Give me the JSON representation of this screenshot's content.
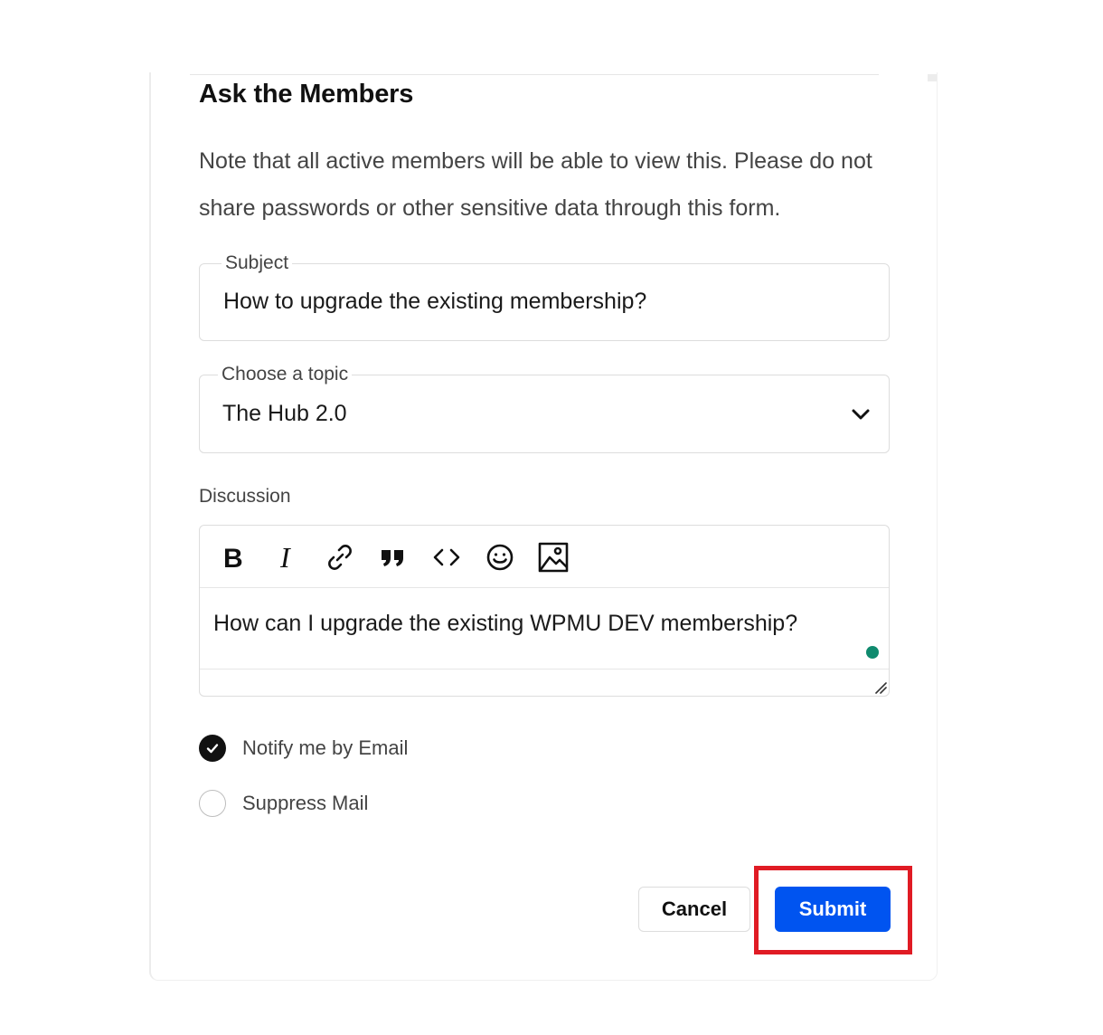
{
  "dialog": {
    "title": "Ask the Members",
    "note": "Note that all active members will be able to view this. Please do not share passwords or other sensitive data through this form."
  },
  "subject": {
    "label": "Subject",
    "value": "How to upgrade the existing membership?"
  },
  "topic": {
    "label": "Choose a topic",
    "selected": "The Hub 2.0",
    "icon": "chevron-down-icon"
  },
  "discussion": {
    "label": "Discussion",
    "toolbar": [
      {
        "name": "bold",
        "icon": "bold-icon"
      },
      {
        "name": "italic",
        "icon": "italic-icon"
      },
      {
        "name": "link",
        "icon": "link-icon"
      },
      {
        "name": "quote",
        "icon": "quote-icon"
      },
      {
        "name": "code",
        "icon": "code-icon"
      },
      {
        "name": "emoji",
        "icon": "emoji-icon"
      },
      {
        "name": "image",
        "icon": "image-icon"
      }
    ],
    "text": "How can I upgrade the existing WPMU DEV membership?",
    "status_color": "#0f8a6e"
  },
  "options": [
    {
      "label": "Notify me by Email",
      "checked": true
    },
    {
      "label": "Suppress Mail",
      "checked": false
    }
  ],
  "actions": {
    "cancel_label": "Cancel",
    "submit_label": "Submit",
    "submit_color": "#0054f0",
    "highlight_color": "#e01b24"
  }
}
